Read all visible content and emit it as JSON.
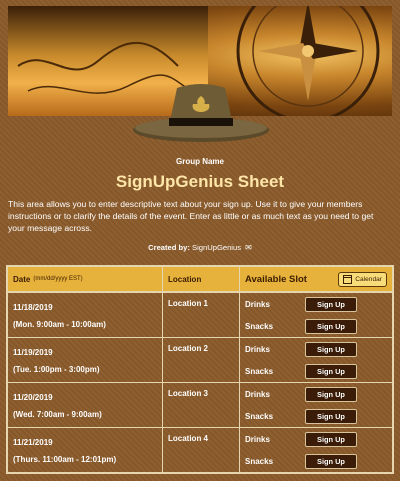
{
  "header": {
    "group_label": "Group Name",
    "title": "SignUpGenius Sheet",
    "description": "This area allows you to enter descriptive text about your sign up. Use it to give your members instructions or to clarify the details of the event. Enter as little or as much text as you need to get your message across.",
    "created_by_label": "Created by:",
    "created_by_name": "SignUpGenius"
  },
  "table": {
    "col_date": "Date",
    "col_date_format": "(mm/dd/yyyy EST)",
    "col_location": "Location",
    "col_slot": "Available Slot",
    "calendar_label": "Calendar",
    "signup_label": "Sign Up",
    "rows": [
      {
        "date": "11/18/2019",
        "time": "(Mon. 9:00am - 10:00am)",
        "location": "Location 1",
        "slots": [
          "Drinks",
          "Snacks"
        ]
      },
      {
        "date": "11/19/2019",
        "time": "(Tue. 1:00pm - 3:00pm)",
        "location": "Location 2",
        "slots": [
          "Drinks",
          "Snacks"
        ]
      },
      {
        "date": "11/20/2019",
        "time": "(Wed. 7:00am - 9:00am)",
        "location": "Location 3",
        "slots": [
          "Drinks",
          "Snacks"
        ]
      },
      {
        "date": "11/21/2019",
        "time": "(Thurs. 11:00am - 12:01pm)",
        "location": "Location 4",
        "slots": [
          "Drinks",
          "Snacks"
        ]
      }
    ]
  },
  "colors": {
    "background": "#8a5a2a",
    "header_bar": "#e7b23b",
    "signup_button": "#3a1c08",
    "title": "#fde6a8"
  }
}
